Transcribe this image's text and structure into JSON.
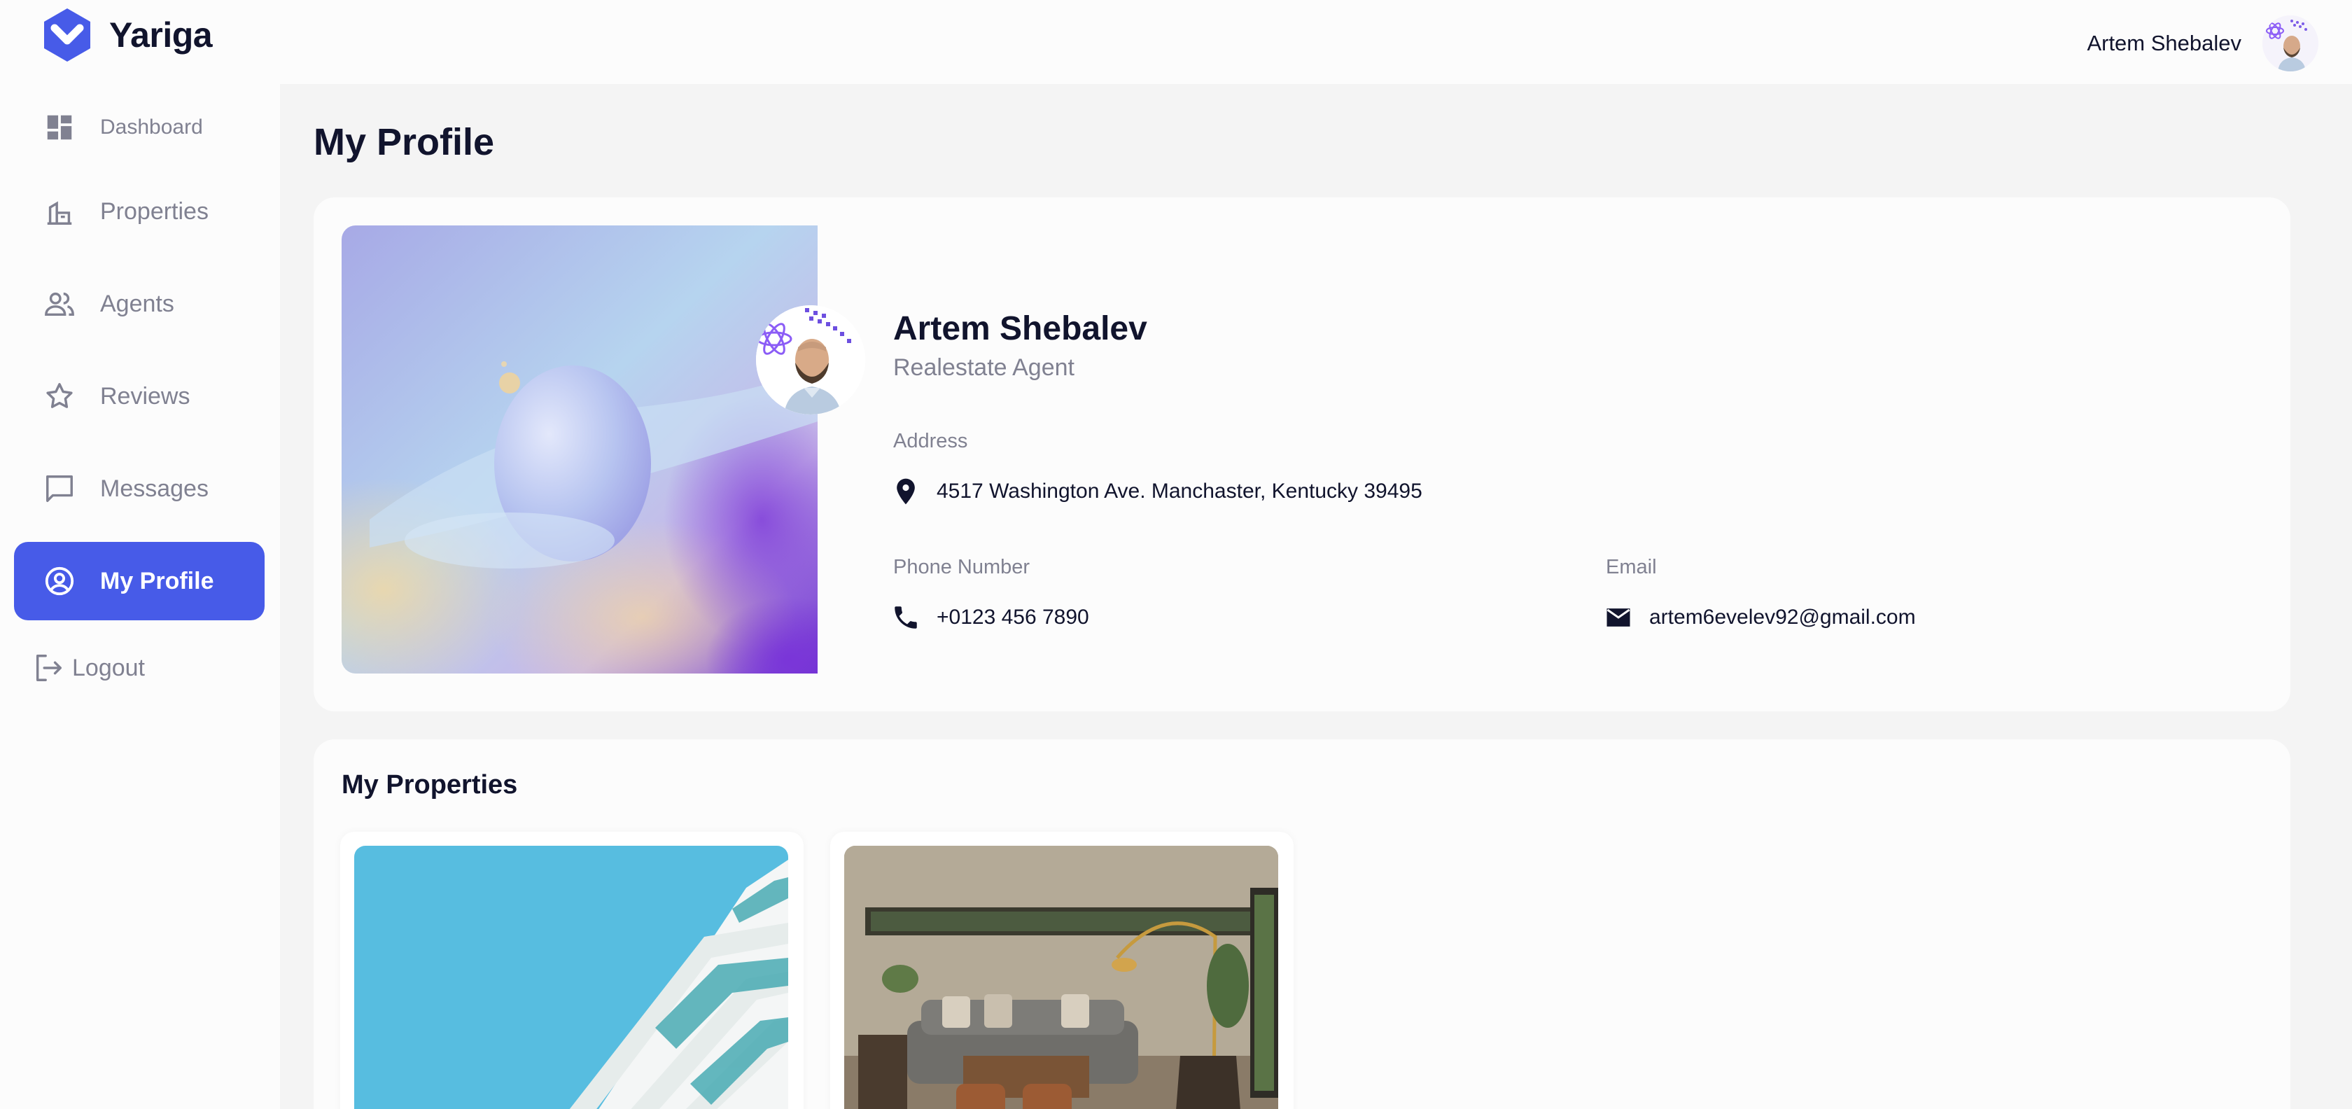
{
  "app": {
    "name": "Yariga",
    "brand_color": "#475be8"
  },
  "header": {
    "user_name": "Artem Shebalev"
  },
  "sidebar": {
    "items": [
      {
        "label": "Dashboard",
        "icon": "dashboard-icon",
        "active": false
      },
      {
        "label": "Properties",
        "icon": "properties-icon",
        "active": false
      },
      {
        "label": "Agents",
        "icon": "agents-icon",
        "active": false
      },
      {
        "label": "Reviews",
        "icon": "star-icon",
        "active": false
      },
      {
        "label": "Messages",
        "icon": "message-icon",
        "active": false
      },
      {
        "label": "My Profile",
        "icon": "profile-icon",
        "active": true
      }
    ],
    "logout": {
      "label": "Logout",
      "icon": "logout-icon"
    }
  },
  "page": {
    "title": "My Profile"
  },
  "profile": {
    "name": "Artem Shebalev",
    "role": "Realestate Agent",
    "address_label": "Address",
    "address": "4517 Washington Ave. Manchaster, Kentucky 39495",
    "phone_label": "Phone Number",
    "phone": "+0123 456 7890",
    "email_label": "Email",
    "email": "artem6evelev92@gmail.com"
  },
  "properties": {
    "title": "My Properties",
    "items": [
      {
        "image": "white-building-photo"
      },
      {
        "image": "living-room-photo"
      }
    ]
  }
}
